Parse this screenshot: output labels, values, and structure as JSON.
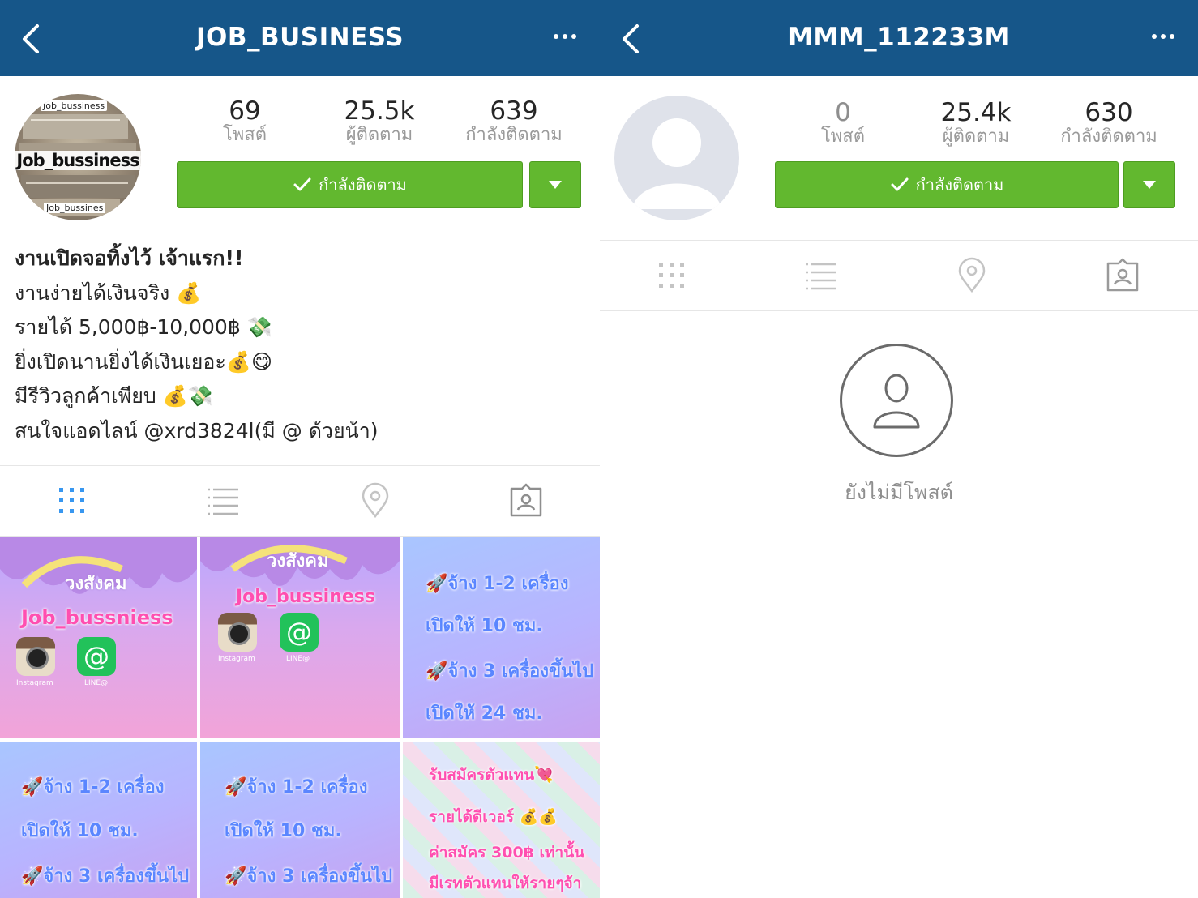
{
  "left": {
    "header": {
      "username": "JOB_BUSINESS"
    },
    "avatar": {
      "label_top": "Job_bussiness",
      "label_main": "Job_bussiness",
      "label_bottom": "Job_bussines"
    },
    "stats": [
      {
        "value": "69",
        "label": "โพสต์"
      },
      {
        "value": "25.5k",
        "label": "ผู้ติดตาม"
      },
      {
        "value": "639",
        "label": "กำลังติดตาม"
      }
    ],
    "follow_button": "กำลังติดตาม",
    "bio": [
      "งานเปิดจอทิ้งไว้ เจ้าแรก!!",
      "งานง่ายได้เงินจริง 💰",
      "รายได้ 5,000฿-10,000฿ 💸",
      "ยิ่งเปิดนานยิ่งได้เงินเยอะ💰😋",
      "มีรีวิวลูกค้าเพียบ 💰💸",
      "สนใจแอดไลน์ @xrd3824l(มี @ ด้วยน้า)"
    ],
    "posts": [
      {
        "title": "วงสังคม",
        "brand": "Job_bussniess",
        "app1": "Instagram",
        "app2": "LINE@"
      },
      {
        "title": "วงสังคม",
        "brand": "Job_bussiness",
        "app1": "Instagram",
        "app2": "LINE@"
      },
      {
        "lines": [
          "🚀จ้าง 1-2 เครื่อง",
          "เปิดให้ 10 ชม.",
          "🚀จ้าง 3 เครื่องขึ้นไป",
          "เปิดให้ 24 ชม."
        ]
      },
      {
        "lines": [
          "🚀จ้าง 1-2 เครื่อง",
          "เปิดให้ 10 ชม.",
          "🚀จ้าง 3 เครื่องขึ้นไป"
        ]
      },
      {
        "lines": [
          "🚀จ้าง 1-2 เครื่อง",
          "เปิดให้ 10 ชม.",
          "🚀จ้าง 3 เครื่องขึ้นไป"
        ]
      },
      {
        "lines": [
          "รับสมัครตัวแทน💘",
          "รายได้ดีเวอร์ 💰💰",
          "ค่าสมัคร 300฿ เท่านั้น",
          "มีเรทตัวแทนให้รายๆจ้า"
        ]
      }
    ]
  },
  "right": {
    "header": {
      "username": "MMM_112233M"
    },
    "stats": [
      {
        "value": "0",
        "label": "โพสต์"
      },
      {
        "value": "25.4k",
        "label": "ผู้ติดตาม"
      },
      {
        "value": "630",
        "label": "กำลังติดตาม"
      }
    ],
    "follow_button": "กำลังติดตาม",
    "empty_text": "ยังไม่มีโพสต์"
  },
  "colors": {
    "navbar": "#165689",
    "follow": "#62b82f",
    "active_tab": "#3897f0"
  }
}
